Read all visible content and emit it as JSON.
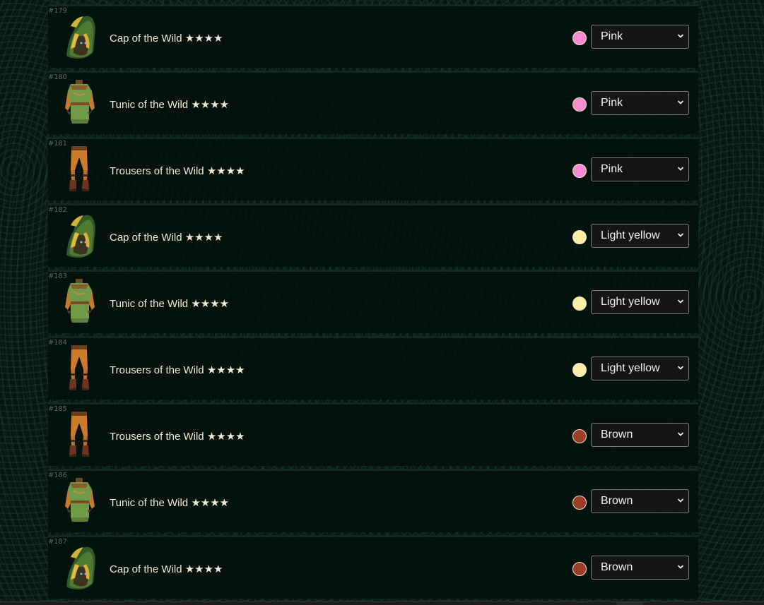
{
  "colors": {
    "Pink": "#f98cd0",
    "Light yellow": "#fbefa6",
    "Brown": "#9c3e26"
  },
  "rows": [
    {
      "num": "#179",
      "name": "Cap of the Wild ★★★★",
      "type": "cap",
      "color": "Pink",
      "thumb_icon": "cap-of-the-wild-icon"
    },
    {
      "num": "#180",
      "name": "Tunic of the Wild ★★★★",
      "type": "tunic",
      "color": "Pink",
      "thumb_icon": "tunic-of-the-wild-icon"
    },
    {
      "num": "#181",
      "name": "Trousers of the Wild ★★★★",
      "type": "trousers",
      "color": "Pink",
      "thumb_icon": "trousers-of-the-wild-icon"
    },
    {
      "num": "#182",
      "name": "Cap of the Wild ★★★★",
      "type": "cap",
      "color": "Light yellow",
      "thumb_icon": "cap-of-the-wild-icon"
    },
    {
      "num": "#183",
      "name": "Tunic of the Wild ★★★★",
      "type": "tunic",
      "color": "Light yellow",
      "thumb_icon": "tunic-of-the-wild-icon"
    },
    {
      "num": "#184",
      "name": "Trousers of the Wild ★★★★",
      "type": "trousers",
      "color": "Light yellow",
      "thumb_icon": "trousers-of-the-wild-icon"
    },
    {
      "num": "#185",
      "name": "Trousers of the Wild ★★★★",
      "type": "trousers",
      "color": "Brown",
      "thumb_icon": "trousers-of-the-wild-icon"
    },
    {
      "num": "#186",
      "name": "Tunic of the Wild ★★★★",
      "type": "tunic",
      "color": "Brown",
      "thumb_icon": "tunic-of-the-wild-icon"
    },
    {
      "num": "#187",
      "name": "Cap of the Wild ★★★★",
      "type": "cap",
      "color": "Brown",
      "thumb_icon": "cap-of-the-wild-icon"
    }
  ]
}
